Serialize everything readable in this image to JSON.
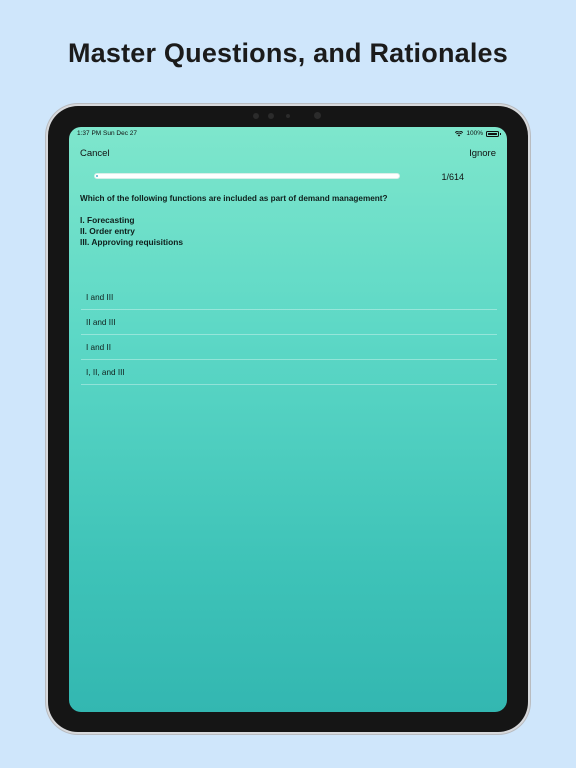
{
  "headline": "Master Questions, and Rationales",
  "status_bar": {
    "time_date": "1:37 PM   Sun Dec 27",
    "battery": "100%",
    "icons": [
      "wifi-icon",
      "battery-icon"
    ]
  },
  "nav": {
    "cancel_label": "Cancel",
    "ignore_label": "Ignore"
  },
  "progress": {
    "fraction": 0.0016,
    "counter": "1/614"
  },
  "question": {
    "text": "Which of the following functions are included as part of demand management?",
    "statements": [
      "I. Forecasting",
      "II. Order entry",
      "III. Approving requisitions"
    ]
  },
  "answers": [
    "I and III",
    "II and III",
    "I and II",
    "I, II, and III"
  ],
  "colors": {
    "background": "#cfe6fb",
    "gradient_top": "#7ee6cc",
    "gradient_bottom": "#33b7b1",
    "progress_fill": "#4ab8cc"
  }
}
